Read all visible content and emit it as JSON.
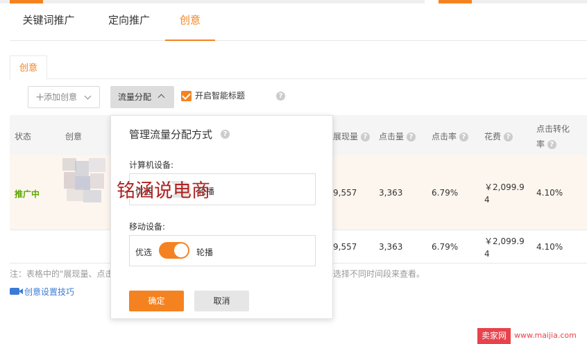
{
  "colors": {
    "accent": "#f58220",
    "status_active": "#5aa500",
    "link": "#3a7bd5"
  },
  "main_tabs": [
    "关键词推广",
    "定向推广",
    "创意"
  ],
  "sub_tab": "创意",
  "toolbar": {
    "add_label": "添加创意",
    "flow_label": "流量分配",
    "smart_title_checked": true,
    "smart_title_label": "开启智能标题"
  },
  "table": {
    "headers": {
      "status": "状态",
      "creative": "创意",
      "impressions": "展现量",
      "clicks": "点击量",
      "ctr": "点击率",
      "cost": "花费",
      "cvr_line1": "点击转化",
      "cvr_line2": "率"
    },
    "rows": [
      {
        "status": "推广中",
        "impressions": "9,557",
        "clicks": "3,363",
        "ctr": "6.79%",
        "cost_line1": "￥2,099.9",
        "cost_line2": "4",
        "cvr": "4.10%"
      },
      {
        "status": "",
        "impressions": "9,557",
        "clicks": "3,363",
        "ctr": "6.79%",
        "cost_line1": "￥2,099.9",
        "cost_line2": "4",
        "cvr": "4.10%"
      }
    ]
  },
  "note_left": "注：表格中的\"展现量、点击",
  "note_right": "选择不同时间段来查看。",
  "tips_label": "创意设置技巧",
  "popup": {
    "title": "管理流量分配方式",
    "pc_label": "计算机设备:",
    "pc_left": "优选",
    "pc_right": "轮播",
    "mobile_label": "移动设备:",
    "mobile_left": "优选",
    "mobile_right": "轮播",
    "mobile_toggle_on": true,
    "confirm": "确定",
    "cancel": "取消"
  },
  "watermark": "铭涵说电商",
  "site_badge": "卖家网",
  "site_url": "www.maijia.com"
}
